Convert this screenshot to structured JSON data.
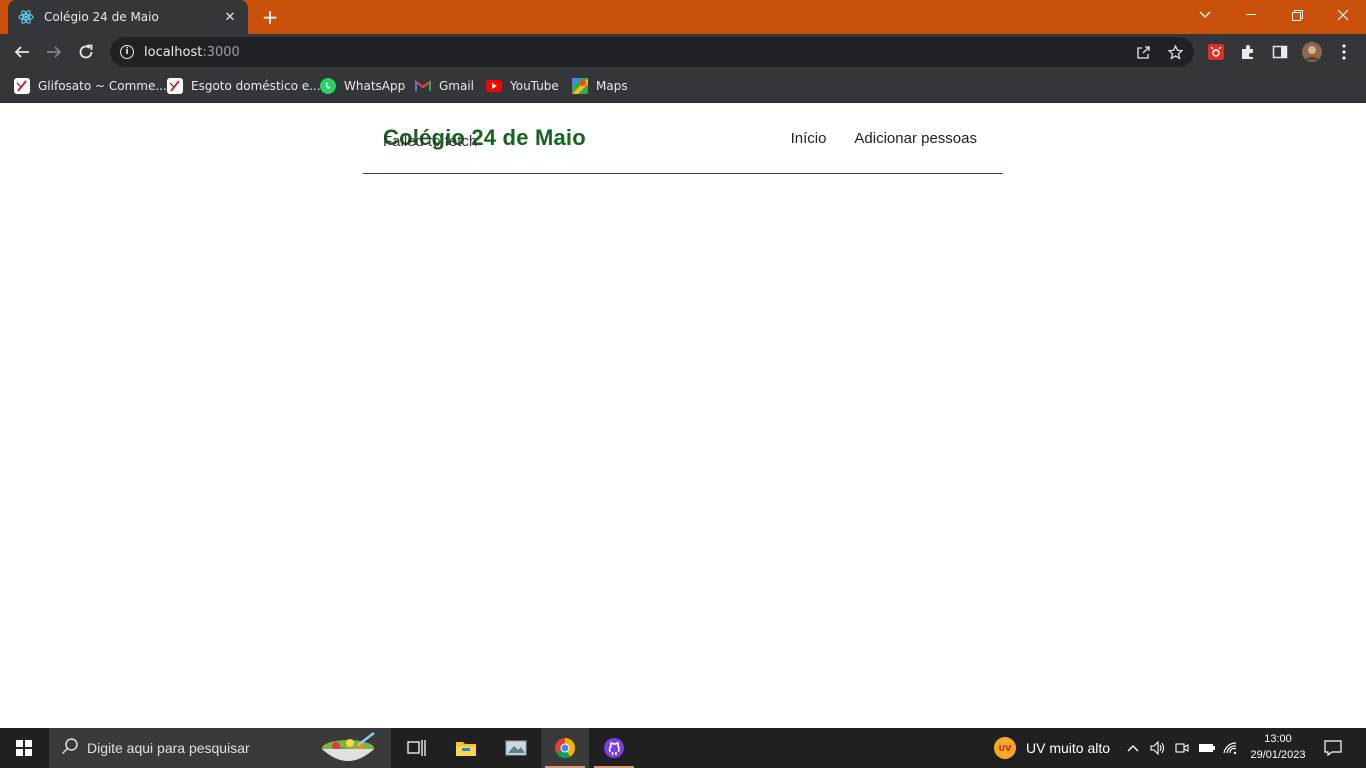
{
  "browser": {
    "tab": {
      "title": "Colégio 24 de Maio",
      "favicon": "react-icon"
    },
    "url_host": "localhost",
    "url_port": ":3000",
    "bookmarks": [
      {
        "label": "Glifosato ~ Comme...",
        "icon": "bookmark-icon"
      },
      {
        "label": "Esgoto doméstico e...",
        "icon": "bookmark-icon"
      },
      {
        "label": "WhatsApp",
        "icon": "whatsapp-icon"
      },
      {
        "label": "Gmail",
        "icon": "gmail-icon"
      },
      {
        "label": "YouTube",
        "icon": "youtube-icon"
      },
      {
        "label": "Maps",
        "icon": "maps-icon"
      }
    ]
  },
  "page": {
    "brand": "Colégio 24 de Maio",
    "nav": {
      "home": "Início",
      "add": "Adicionar pessoas"
    },
    "error_message": "Failed to fetch"
  },
  "taskbar": {
    "search_placeholder": "Digite aqui para pesquisar",
    "weather": "UV muito alto",
    "uv_badge": "UV",
    "time": "13:00",
    "date": "29/01/2023"
  },
  "colors": {
    "titlebar": "#c9510c",
    "chrome_dark": "#35363a",
    "brand_green": "#14631f"
  }
}
